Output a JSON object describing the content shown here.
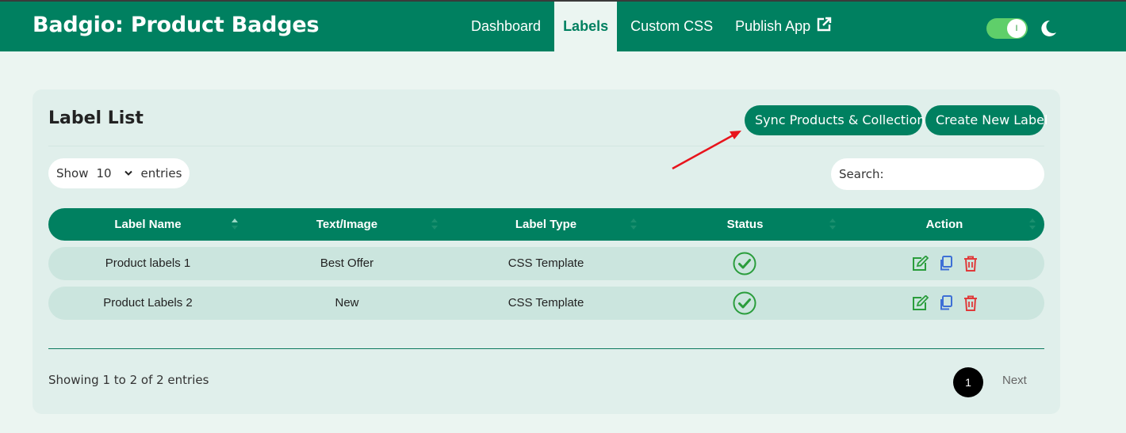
{
  "app": {
    "title": "Badgio: Product Badges"
  },
  "nav": {
    "items": [
      {
        "label": "Dashboard",
        "active": false
      },
      {
        "label": "Labels",
        "active": true
      },
      {
        "label": "Custom CSS",
        "active": false
      },
      {
        "label": "Publish App",
        "active": false,
        "icon": "external-link-icon"
      }
    ]
  },
  "header_controls": {
    "toggle_knob_text": "I",
    "theme_icon": "moon-icon"
  },
  "card": {
    "title": "Label List",
    "sync_button": "Sync Products & Collections",
    "create_button": "Create New Label"
  },
  "table_controls": {
    "show_label": "Show",
    "entries_value": "10",
    "entries_label": "entries",
    "search_label": "Search:"
  },
  "table": {
    "columns": [
      "Label Name",
      "Text/Image",
      "Label Type",
      "Status",
      "Action"
    ],
    "rows": [
      {
        "label_name": "Product labels 1",
        "text_image": "Best Offer",
        "label_type": "CSS Template",
        "status": "active"
      },
      {
        "label_name": "Product Labels 2",
        "text_image": "New",
        "label_type": "CSS Template",
        "status": "active"
      }
    ],
    "action_icons": [
      "edit-icon",
      "copy-icon",
      "delete-icon"
    ]
  },
  "footer": {
    "info": "Showing 1 to 2 of 2 entries",
    "current_page": "1",
    "next_label": "Next"
  },
  "colors": {
    "brand": "#008060",
    "page_bg": "#ebf5f1",
    "card_bg": "#e0efeb",
    "row_bg": "#cbe5de",
    "status_green": "#2a9d3c",
    "edit_green": "#2a9d3c",
    "copy_blue": "#3d6fd6",
    "delete_red": "#e03a3a",
    "annotation_arrow": "#e8141c"
  }
}
